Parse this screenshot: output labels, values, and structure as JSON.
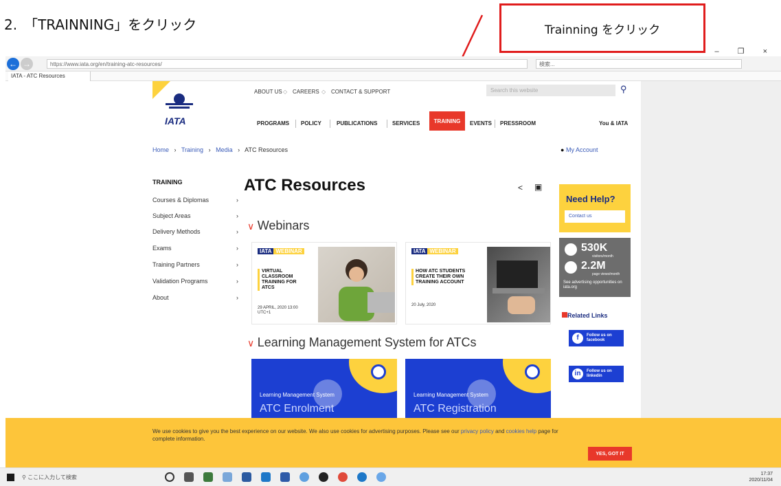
{
  "instruction": "2.　「TRAINNING」をクリック",
  "callout": "Trainning をクリック",
  "browser": {
    "url": "https://www.iata.org/en/training-atc-resources/",
    "search_placeholder": "検索...",
    "tab_title": "IATA - ATC Resources",
    "window_controls": "– ❐ ×"
  },
  "site": {
    "logo_text": "IATA",
    "top_links": [
      "ABOUT US",
      "CAREERS",
      "CONTACT & SUPPORT"
    ],
    "search_placeholder": "Search this website",
    "menu": [
      "PROGRAMS",
      "POLICY",
      "PUBLICATIONS",
      "SERVICES",
      "TRAINING",
      "EVENTS",
      "PRESSROOM"
    ],
    "you_iata": "You & IATA",
    "breadcrumb": [
      "Home",
      "Training",
      "Media",
      "ATC Resources"
    ],
    "my_account": "My Account",
    "sidebar_heading": "TRAINING",
    "sidebar_items": [
      "Courses & Diplomas",
      "Subject Areas",
      "Delivery Methods",
      "Exams",
      "Training Partners",
      "Validation Programs",
      "About"
    ],
    "page_title": "ATC Resources",
    "section_webinars": "Webinars",
    "webinars": [
      {
        "badge_a": "IATA",
        "badge_b": "WEBINAR",
        "title": "VIRTUAL CLASSROOM TRAINING FOR ATCS",
        "date": "29 APRIL, 2020 13:00 UTC+1"
      },
      {
        "badge_a": "IATA",
        "badge_b": "WEBINAR",
        "title": "HOW ATC STUDENTS CREATE THEIR OWN TRAINING ACCOUNT",
        "date": "20 July, 2020"
      }
    ],
    "section_lms": "Learning Management System for ATCs",
    "lms_cards": [
      {
        "subtitle": "Learning Management System",
        "title": "ATC Enrolment"
      },
      {
        "subtitle": "Learning Management System",
        "title": "ATC Registration"
      }
    ],
    "help_title": "Need Help?",
    "contact": "Contact us",
    "ad": {
      "visitors": "530K",
      "visitors_label": "visitors/month",
      "views": "2.2M",
      "views_label": "page views/month",
      "footer": "See advertising opportunities on iata.org"
    },
    "related_title": "Related Links",
    "social": [
      {
        "icon": "f",
        "line1": "Follow us on",
        "line2": "facebook"
      },
      {
        "icon": "in",
        "line1": "Follow us on",
        "line2": "linkedin"
      }
    ],
    "cookie_text_1": "We use cookies to give you the best experience on our website. We also use cookies for advertising purposes. Please see our ",
    "cookie_link_1": "privacy policy",
    "cookie_text_2": " and ",
    "cookie_link_2": "cookies help",
    "cookie_text_3": " page for complete information.",
    "cookie_button": "YES, GOT IT"
  },
  "taskbar": {
    "search_placeholder": "ここに入力して検索",
    "time": "17:37",
    "date": "2020/11/04"
  },
  "colors": {
    "accent_red": "#e8382a",
    "iata_blue": "#1a2c80",
    "yellow": "#fdc53a"
  }
}
